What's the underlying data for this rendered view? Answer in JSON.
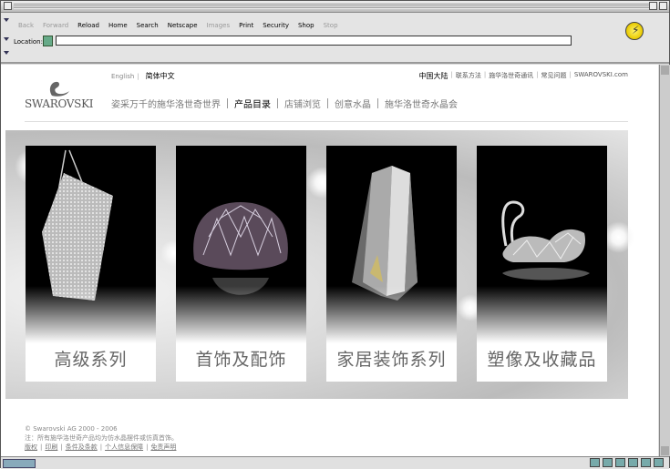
{
  "browser": {
    "nav_buttons": [
      {
        "label": "Back",
        "enabled": false
      },
      {
        "label": "Forward",
        "enabled": false
      },
      {
        "label": "Reload",
        "enabled": true
      },
      {
        "label": "Home",
        "enabled": true
      },
      {
        "label": "Search",
        "enabled": true
      },
      {
        "label": "Netscape",
        "enabled": true
      },
      {
        "label": "Images",
        "enabled": false
      },
      {
        "label": "Print",
        "enabled": true
      },
      {
        "label": "Security",
        "enabled": true
      },
      {
        "label": "Shop",
        "enabled": true
      },
      {
        "label": "Stop",
        "enabled": false
      }
    ],
    "location_label": "Location:",
    "location_value": ""
  },
  "page": {
    "lang": {
      "english": "English",
      "separator": "|",
      "chinese": "简体中文"
    },
    "top_links": {
      "region": "中国大陆",
      "items": [
        "联系方法",
        "施华洛世奇通讯",
        "常见问题",
        "SWAROVSKI.com"
      ],
      "separator": "|"
    },
    "logo": {
      "text": "SWAROVSKI"
    },
    "menu": [
      {
        "label": "姿采万千的施华洛世奇世界",
        "active": false
      },
      {
        "label": "产品目录",
        "active": true
      },
      {
        "label": "店铺浏览",
        "active": false
      },
      {
        "label": "创意水晶",
        "active": false
      },
      {
        "label": "施华洛世奇水晶会",
        "active": false
      }
    ],
    "cards": [
      {
        "label": "高级系列",
        "icon": "crystal-handbag"
      },
      {
        "label": "首饰及配饰",
        "icon": "crystal-pendant"
      },
      {
        "label": "家居装饰系列",
        "icon": "crystal-vase"
      },
      {
        "label": "塑像及收藏品",
        "icon": "crystal-swan"
      }
    ],
    "footer": {
      "copyright": "© Swarovski AG 2000 - 2006",
      "note": "注：所有施华洛世奇产品均为仿水晶摆件或仿真首饰。",
      "links": [
        "版权",
        "印刷",
        "条件及条款",
        "个人信息保障",
        "免责声明"
      ]
    }
  }
}
